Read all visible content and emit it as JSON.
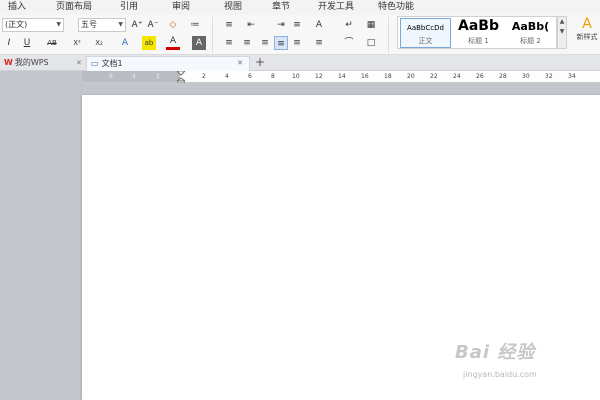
{
  "menu": [
    "插入",
    "页面布局",
    "引用",
    "审阅",
    "视图",
    "章节",
    "开发工具",
    "特色功能"
  ],
  "font": {
    "name": "(正文)",
    "size": "五号"
  },
  "toolbar_row1": [
    "A⁺",
    "A⁻",
    "◇",
    "≔",
    "≡",
    "⇤",
    "⇥",
    "A",
    "↵",
    "▦"
  ],
  "toolbar_row2": [
    "I",
    "U",
    "AB",
    "X²",
    "X₂",
    "A",
    "ab",
    "A",
    "A",
    "≡",
    "≡",
    "≡",
    "≡",
    "≡",
    "≡",
    "⌒",
    "□"
  ],
  "styles": [
    {
      "preview": "AaBbCcDd",
      "name": "正文"
    },
    {
      "preview": "AaBb",
      "name": "标题 1"
    },
    {
      "preview": "AaBb(",
      "name": "标题 2"
    }
  ],
  "new_style": {
    "icon": "A",
    "label": "新样式"
  },
  "tabs": {
    "home": "我的WPS",
    "doc": "文档1",
    "add": "+"
  },
  "ruler_numbers": [
    "6",
    "4",
    "2",
    "2",
    "4",
    "6",
    "8",
    "10",
    "12",
    "14",
    "16",
    "18",
    "20",
    "22",
    "24",
    "26",
    "28",
    "30",
    "32",
    "34"
  ],
  "watermark": {
    "main": "Bai 经验",
    "sub": "jingyan.baidu.com"
  },
  "colors": {
    "accent": "#2f6db5",
    "wps_logo": "#d9261c",
    "highlight": "#f5e600",
    "font_color": "#d00000"
  }
}
